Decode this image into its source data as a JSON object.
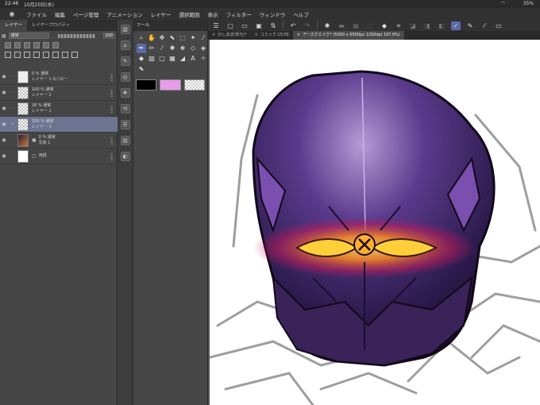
{
  "status": {
    "time": "22:46",
    "date": "10月20日(水)",
    "battery": "35%"
  },
  "menu": [
    "ファイル",
    "編集",
    "ページ管理",
    "アニメーション",
    "レイヤー",
    "選択範囲",
    "表示",
    "フィルター",
    "ウィンドウ",
    "ヘルプ"
  ],
  "layer_panel": {
    "tabs": [
      "レイヤー",
      "レイヤープロパティ"
    ],
    "blend_mode": "通常",
    "opacity": "100",
    "layers": [
      {
        "mode": "0 % 通常",
        "name": "レイヤー 1 のコピー",
        "thumb": "sketch",
        "selected": false
      },
      {
        "mode": "100 % 通常",
        "name": "レイヤー 2",
        "thumb": "transparent",
        "selected": false
      },
      {
        "mode": "26 % 通常",
        "name": "レイヤー 1",
        "thumb": "transparent",
        "selected": false
      },
      {
        "mode": "100 % 通常",
        "name": "レイヤー 3",
        "thumb": "transparent",
        "selected": true
      },
      {
        "mode": "0 % 通常",
        "name": "写真 1",
        "thumb": "photo",
        "selected": false
      },
      {
        "mode": "",
        "name": "用紙",
        "thumb": "white",
        "selected": false
      }
    ]
  },
  "tool_panel": {
    "tab": "ツール"
  },
  "colors": {
    "main": "#000000",
    "sub": "#e89ce8",
    "accent": "#5b6aa8",
    "selected_layer": "#6c7491"
  },
  "canvas_tabs": [
    {
      "label": "かしまぼ(背元)*",
      "active": false
    },
    {
      "label": "コミック 15/36",
      "active": false
    },
    {
      "label": "アースクエイク* (5000 x 6000px 1200dpi 197.9%)",
      "active": true
    }
  ]
}
